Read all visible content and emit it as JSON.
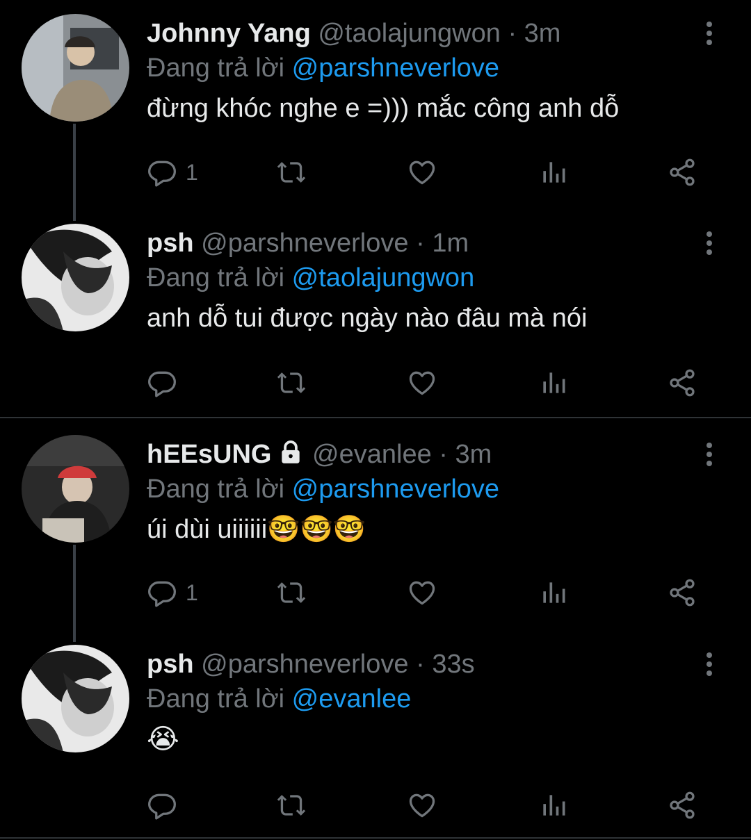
{
  "replying_prefix": "Đang trả lời",
  "colors": {
    "background": "#000000",
    "mention": "#1d9bf0",
    "muted": "#71767b",
    "text": "#e7e9ea"
  },
  "tweets": [
    {
      "name": "Johnny Yang",
      "handle": "@taolajungwon",
      "time": "3m",
      "reply_to": "@parshneverlove",
      "text": "đừng khóc nghe e =))) mắc công anh dỗ",
      "reply_count": "1",
      "icons": [
        "reply-icon",
        "retweet-icon",
        "like-icon",
        "views-icon",
        "share-icon"
      ]
    },
    {
      "name": "psh",
      "handle": "@parshneverlove",
      "time": "1m",
      "reply_to": "@taolajungwon",
      "text": "anh dỗ tui được ngày nào đâu mà nói",
      "reply_count": ""
    },
    {
      "name": "hEEsUNG",
      "protected": true,
      "handle": "@evanlee",
      "time": "3m",
      "reply_to": "@parshneverlove",
      "text": "úi dùi uiiiiii🤓🤓🤓",
      "reply_count": "1"
    },
    {
      "name": "psh",
      "handle": "@parshneverlove",
      "time": "33s",
      "reply_to": "@evanlee",
      "text": "😭",
      "reply_count": ""
    }
  ]
}
